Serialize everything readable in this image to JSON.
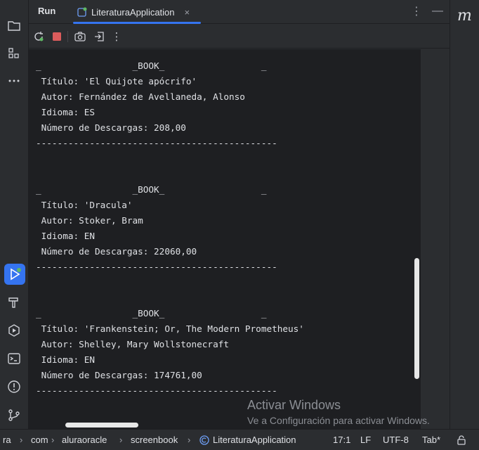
{
  "header": {
    "title": "Run",
    "tab_label": "LiteraturaApplication",
    "tab_close": "×",
    "more": "⋮",
    "minimize": "—"
  },
  "toolbar": {
    "more": "⋮"
  },
  "right_strip": {
    "label": "m"
  },
  "console": {
    "lines": [
      "_                 _BOOK_                  _",
      " Título: 'El Quijote apócrifo'",
      " Autor: Fernández de Avellaneda, Alonso",
      " Idioma: ES",
      " Número de Descargas: 208,00",
      "---------------------------------------------",
      "",
      "",
      "_                 _BOOK_                  _",
      " Título: 'Dracula'",
      " Autor: Stoker, Bram",
      " Idioma: EN",
      " Número de Descargas: 22060,00",
      "---------------------------------------------",
      "",
      "",
      "_                 _BOOK_                  _",
      " Título: 'Frankenstein; Or, The Modern Prometheus'",
      " Autor: Shelley, Mary Wollstonecraft",
      " Idioma: EN",
      " Número de Descargas: 174761,00",
      "---------------------------------------------"
    ]
  },
  "watermark": {
    "title": "Activar Windows",
    "subtitle": "Ve a Configuración para activar Windows."
  },
  "statusbar": {
    "crumbs": [
      "ra",
      "com",
      "aluraoracle",
      "screenbook",
      "LiteraturaApplication"
    ],
    "separator": "›",
    "position": "17:1",
    "line_ending": "LF",
    "encoding": "UTF-8",
    "indent": "Tab*"
  },
  "colors": {
    "accent": "#3574f0",
    "stop": "#db5c5c",
    "run_badge": "#5fb865"
  }
}
